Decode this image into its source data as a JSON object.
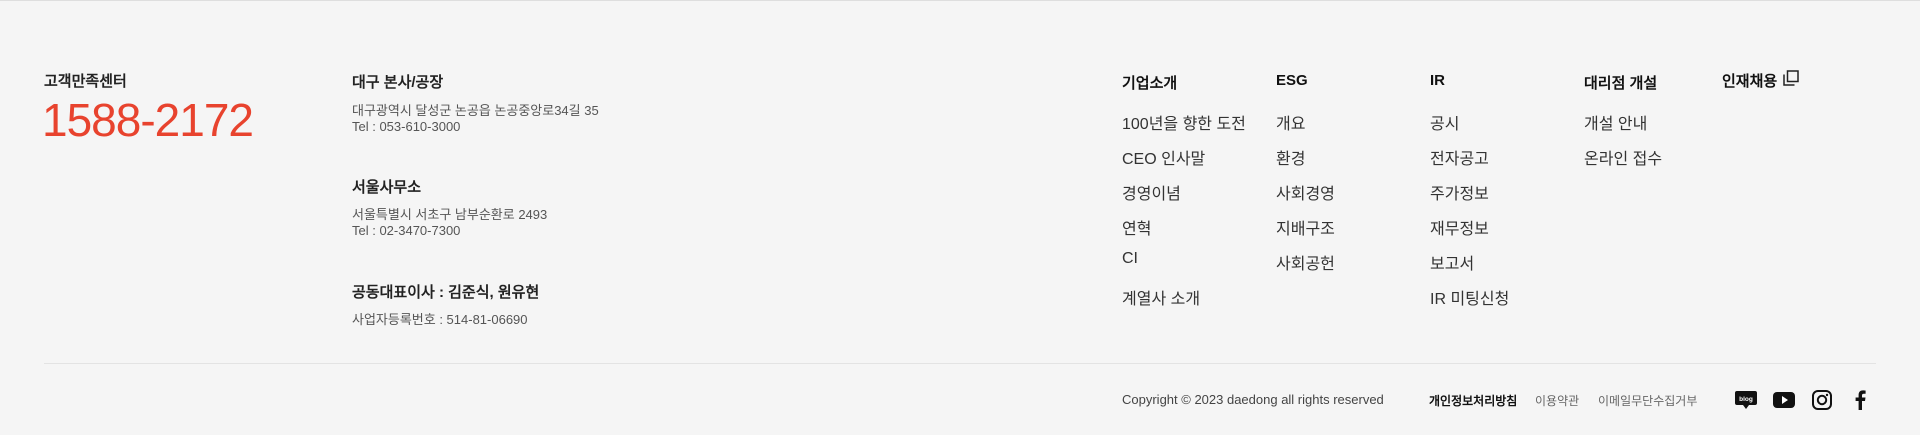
{
  "customer_center": {
    "title": "고객만족센터",
    "phone": "1588-2172"
  },
  "offices": {
    "daegu": {
      "title": "대구 본사/공장",
      "address": "대구광역시 달성군 논공읍 논공중앙로34길 35",
      "tel": "Tel : 053-610-3000"
    },
    "seoul": {
      "title": "서울사무소",
      "address": "서울특별시 서초구 남부순환로 2493",
      "tel": "Tel : 02-3470-7300"
    },
    "ceo": {
      "title": "공동대표이사 : 김준식, 원유현",
      "reg": "사업자등록번호 : 514-81-06690"
    }
  },
  "nav": {
    "company": {
      "title": "기업소개",
      "items": [
        "100년을 향한 도전",
        "CEO 인사말",
        "경영이념",
        "연혁",
        "CI",
        "계열사 소개"
      ]
    },
    "esg": {
      "title": "ESG",
      "items": [
        "개요",
        "환경",
        "사회경영",
        "지배구조",
        "사회공헌"
      ]
    },
    "ir": {
      "title": "IR",
      "items": [
        "공시",
        "전자공고",
        "주가정보",
        "재무정보",
        "보고서",
        "IR 미팅신청"
      ]
    },
    "dealer": {
      "title": "대리점 개설",
      "items": [
        "개설 안내",
        "온라인 접수"
      ]
    },
    "recruit": {
      "title": "인재채용",
      "icon": "external-link-icon"
    }
  },
  "bottom": {
    "copyright": "Copyright © 2023 daedong all rights reserved",
    "privacy": "개인정보처리방침",
    "terms": "이용약관",
    "email_refusal": "이메일무단수집거부",
    "social": [
      "blog-icon",
      "youtube-icon",
      "instagram-icon",
      "facebook-icon"
    ]
  },
  "colors": {
    "accent": "#e8432e",
    "background": "#f5f5f5"
  }
}
